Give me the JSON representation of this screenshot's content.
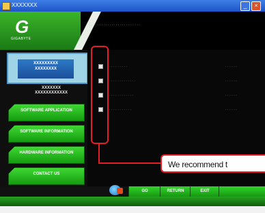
{
  "window": {
    "title": "XXXXXXX",
    "minimize_label": "_",
    "close_label": "×"
  },
  "header": {
    "logo_letter": "G",
    "logo_sub": "GIGABYTE",
    "text": "· · · · · · · · · · · · · · · · · · · · · · · · ·"
  },
  "sidebar": {
    "active": {
      "label": "XXXXXXXXX\nXXXXXXXX"
    },
    "sub_label": "XXXXXXX\nXXXXXXXXXXXX",
    "items": [
      {
        "label": "SOFTWARE APPLICATION"
      },
      {
        "label": "SOFTWARE INFORMATION"
      },
      {
        "label": "HARDWARE INFORMATION"
      },
      {
        "label": "CONTACT US"
      }
    ]
  },
  "content": {
    "rows": [
      {
        "name": "· · · · · · · · ·",
        "version": "· · · · · ·"
      },
      {
        "name": "· · · · · · · · · · · · ·",
        "version": "· · · · · ·"
      },
      {
        "name": "· · · · · · · · · · · ·",
        "version": "· · · · · ·"
      },
      {
        "name": "· · · · · · · · · · ·",
        "version": "· · · · · ·"
      }
    ]
  },
  "callout": {
    "text": "We recommend t"
  },
  "bottom": {
    "go": "GO",
    "return": "RETURN",
    "exit": "EXIT"
  },
  "colors": {
    "accent_green": "#22b11b",
    "highlight_red": "#e31e24",
    "active_blue": "#2c79c7"
  }
}
